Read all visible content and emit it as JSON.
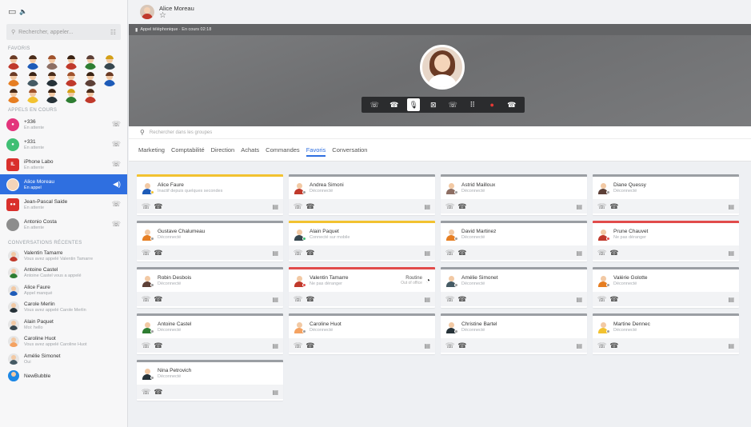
{
  "sidebar": {
    "search_placeholder": "Rechercher, appeler...",
    "favorites_label": "FAVORIS",
    "calls_label": "APPELS EN COURS",
    "recent_label": "CONVERSATIONS RÉCENTES",
    "calls": [
      {
        "name": "+336",
        "sub": "En attente",
        "avatar_color": "#e3347c",
        "initials": ""
      },
      {
        "name": "+331",
        "sub": "En attente",
        "avatar_color": "#3fbf74",
        "initials": ""
      },
      {
        "name": "iPhone Labo",
        "sub": "En attente",
        "avatar_color": "#d9302c",
        "initials": "IL"
      },
      {
        "name": "Alice Moreau",
        "sub": "En appel",
        "avatar_color": "#c0392b",
        "initials": ""
      },
      {
        "name": "Jean-Pascal Saide",
        "sub": "En attente",
        "avatar_color": "#d9302c",
        "initials": ""
      },
      {
        "name": "Antonio Costa",
        "sub": "En attente",
        "avatar_color": "#6d6d6d",
        "initials": ""
      }
    ],
    "conversations": [
      {
        "name": "Valentin Tamarre",
        "sub": "Vous avez appelé Valentin Tamarre",
        "color": "#c0392b"
      },
      {
        "name": "Antoine Castel",
        "sub": "Antoine Castel vous a appelé",
        "color": "#2e7d32"
      },
      {
        "name": "Alice Faure",
        "sub": "Appel manqué",
        "color": "#1e5bb8"
      },
      {
        "name": "Carole Merlin",
        "sub": "Vous avez appelé Carole Merlin",
        "color": "#263238"
      },
      {
        "name": "Alain Paquet",
        "sub": "Moi: hello",
        "color": "#37474f"
      },
      {
        "name": "Caroline Huot",
        "sub": "Vous avez appelé Caroline Huot",
        "color": "#f4a261"
      },
      {
        "name": "Amélie Simonet",
        "sub": "Oui",
        "color": "#455a64"
      },
      {
        "name": "NewBubble",
        "sub": "",
        "color": "#1e88e5"
      }
    ]
  },
  "header": {
    "contact_name": "Alice Moreau",
    "call_status": "Appel téléphonique · En cours 02:18"
  },
  "groups": {
    "search_placeholder": "Rechercher dans les groupes",
    "tabs": [
      "Marketing",
      "Comptabilité",
      "Direction",
      "Achats",
      "Commandes",
      "Favoris",
      "Conversation"
    ],
    "active_tab": "Favoris"
  },
  "contacts": [
    {
      "name": "Alice Faure",
      "status": "Inactif depuis quelques secondes",
      "bar": "yellow",
      "dot": "#f2c230",
      "color": "#1e5bb8"
    },
    {
      "name": "Andrea Simoni",
      "status": "Déconnecté",
      "bar": "grey",
      "dot": "#9e9e9e",
      "color": "#c0392b"
    },
    {
      "name": "Astrid Mailloux",
      "status": "Déconnecté",
      "bar": "grey",
      "dot": "#9e9e9e",
      "color": "#8d6e63"
    },
    {
      "name": "Diane Quessy",
      "status": "Déconnecté",
      "bar": "grey",
      "dot": "#9e9e9e",
      "color": "#5d4037"
    },
    {
      "name": "Gustave Chalumeau",
      "status": "Déconnecté",
      "bar": "grey",
      "dot": "#9e9e9e",
      "color": "#e67e22"
    },
    {
      "name": "Alain Paquet",
      "status": "Connecté sur mobile",
      "bar": "yellow",
      "dot": "#3fbf74",
      "color": "#37474f"
    },
    {
      "name": "David Martinez",
      "status": "Déconnecté",
      "bar": "grey",
      "dot": "#9e9e9e",
      "color": "#e67e22"
    },
    {
      "name": "Prune Chauvet",
      "status": "Ne pas déranger",
      "bar": "red",
      "dot": "#e14b4b",
      "color": "#c0392b"
    },
    {
      "name": "Robin Desbois",
      "status": "Déconnecté",
      "bar": "grey",
      "dot": "#9e9e9e",
      "color": "#5d4037"
    },
    {
      "name": "Valentin Tamarre",
      "status": "Ne pas déranger",
      "bar": "red",
      "dot": "#e14b4b",
      "color": "#c0392b",
      "extra": "Routine",
      "extra_sub": "Out of office"
    },
    {
      "name": "Amélie Simonet",
      "status": "Déconnecté",
      "bar": "grey",
      "dot": "#9e9e9e",
      "color": "#455a64"
    },
    {
      "name": "Valérie Golotte",
      "status": "Déconnecté",
      "bar": "grey",
      "dot": "#9e9e9e",
      "color": "#e67e22"
    },
    {
      "name": "Antoine Castel",
      "status": "Déconnecté",
      "bar": "grey",
      "dot": "#9e9e9e",
      "color": "#2e7d32"
    },
    {
      "name": "Caroline Huot",
      "status": "Déconnecté",
      "bar": "grey",
      "dot": "#9e9e9e",
      "color": "#f4a261"
    },
    {
      "name": "Christine Bartel",
      "status": "Déconnecté",
      "bar": "grey",
      "dot": "#9e9e9e",
      "color": "#263238"
    },
    {
      "name": "Martine Dennec",
      "status": "Déconnecté",
      "bar": "grey",
      "dot": "#9e9e9e",
      "color": "#f2c230"
    },
    {
      "name": "Nina Petrovich",
      "status": "Déconnecté",
      "bar": "grey",
      "dot": "#9e9e9e",
      "color": "#263238"
    }
  ]
}
